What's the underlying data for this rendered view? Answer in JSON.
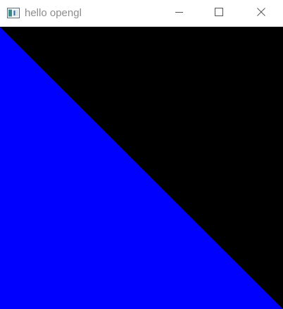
{
  "window": {
    "title": "hello opengl",
    "icon": "app-window-icon",
    "controls": [
      "minimize-icon",
      "maximize-icon",
      "close-icon"
    ]
  },
  "viewport": {
    "clear_color": "#000000",
    "triangle_color": "#0000ff",
    "shape": "triangle"
  }
}
